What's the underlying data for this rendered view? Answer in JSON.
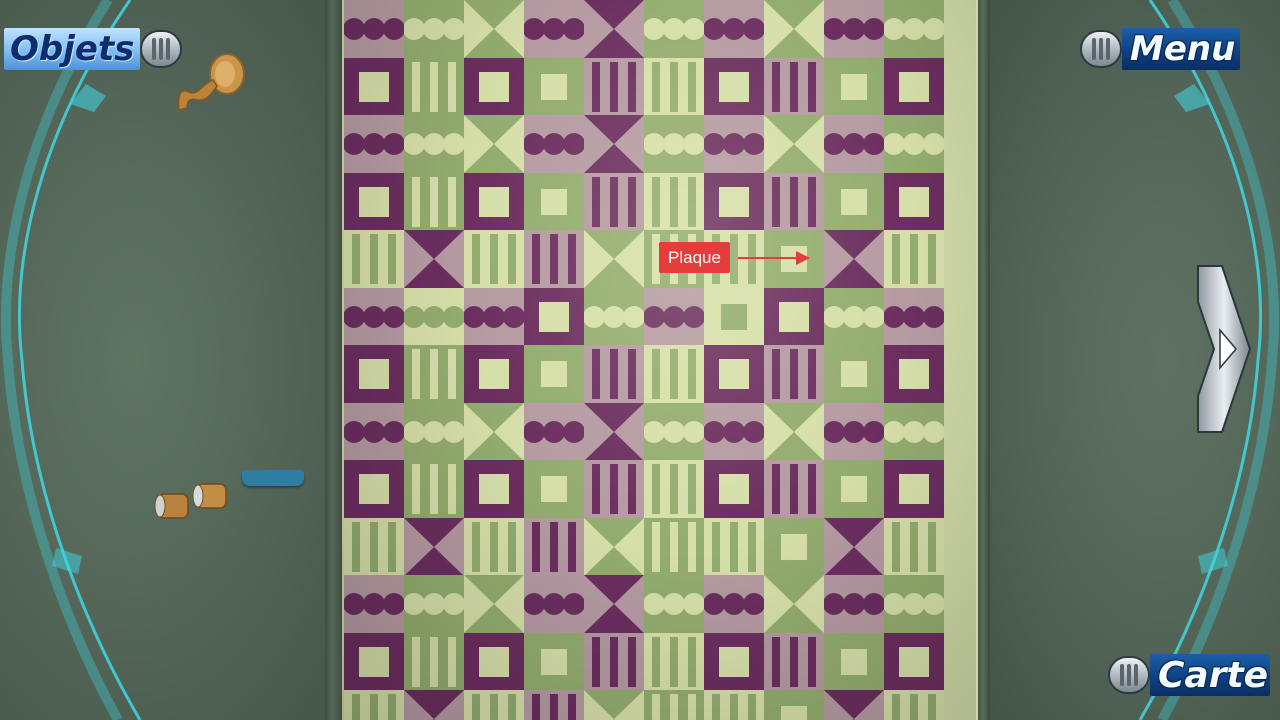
{
  "hud": {
    "objets_label": "Objets",
    "menu_label": "Menu",
    "carte_label": "Carte"
  },
  "annotation": {
    "plaque_label": "Plaque",
    "color": "#e53c3c"
  },
  "colors": {
    "hud_cyan": "#3fd8e6",
    "tile_purple": "#6b2e5f",
    "tile_light": "#d6dfaa",
    "tile_green": "#93ac6f",
    "tile_mauve": "#b59aa2"
  },
  "icons": {
    "next": "chevron-right-icon"
  }
}
